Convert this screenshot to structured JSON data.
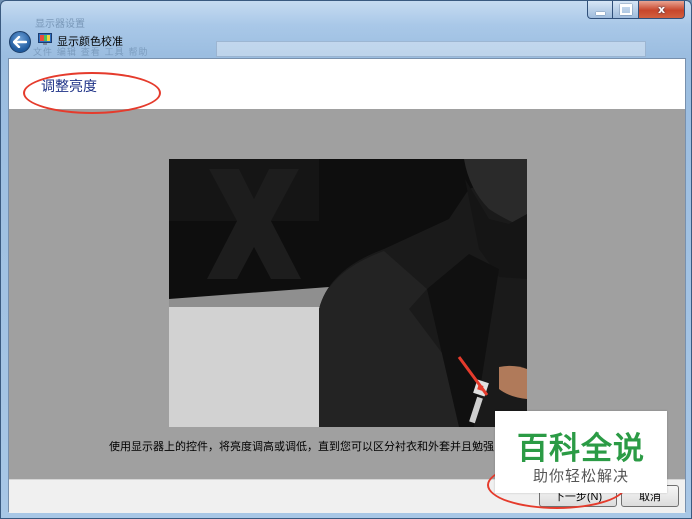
{
  "window": {
    "title": "显示颜色校准",
    "ghost_title": "显示器设置",
    "ghost_menu": "文件    编辑    查看    工具    帮助"
  },
  "icons": {
    "back": "back-arrow-icon",
    "app": "display-color-calibration-icon",
    "minimize": "minimize-icon",
    "maximize": "maximize-icon",
    "close": "close-icon"
  },
  "caption": {
    "close_label": "x"
  },
  "page": {
    "heading": "调整亮度",
    "instruction": "使用显示器上的控件，将亮度调高或调低，直到您可以区分衬衣和外套并且勉强"
  },
  "buttons": {
    "next_label": "下一步(N)",
    "cancel_label": "取消"
  },
  "watermark": {
    "main": "百科全说",
    "sub": "助你轻松解决"
  },
  "colors": {
    "annotation": "#e53b2c",
    "heading": "#1e3287",
    "watermark_green": "#2b9b45"
  }
}
